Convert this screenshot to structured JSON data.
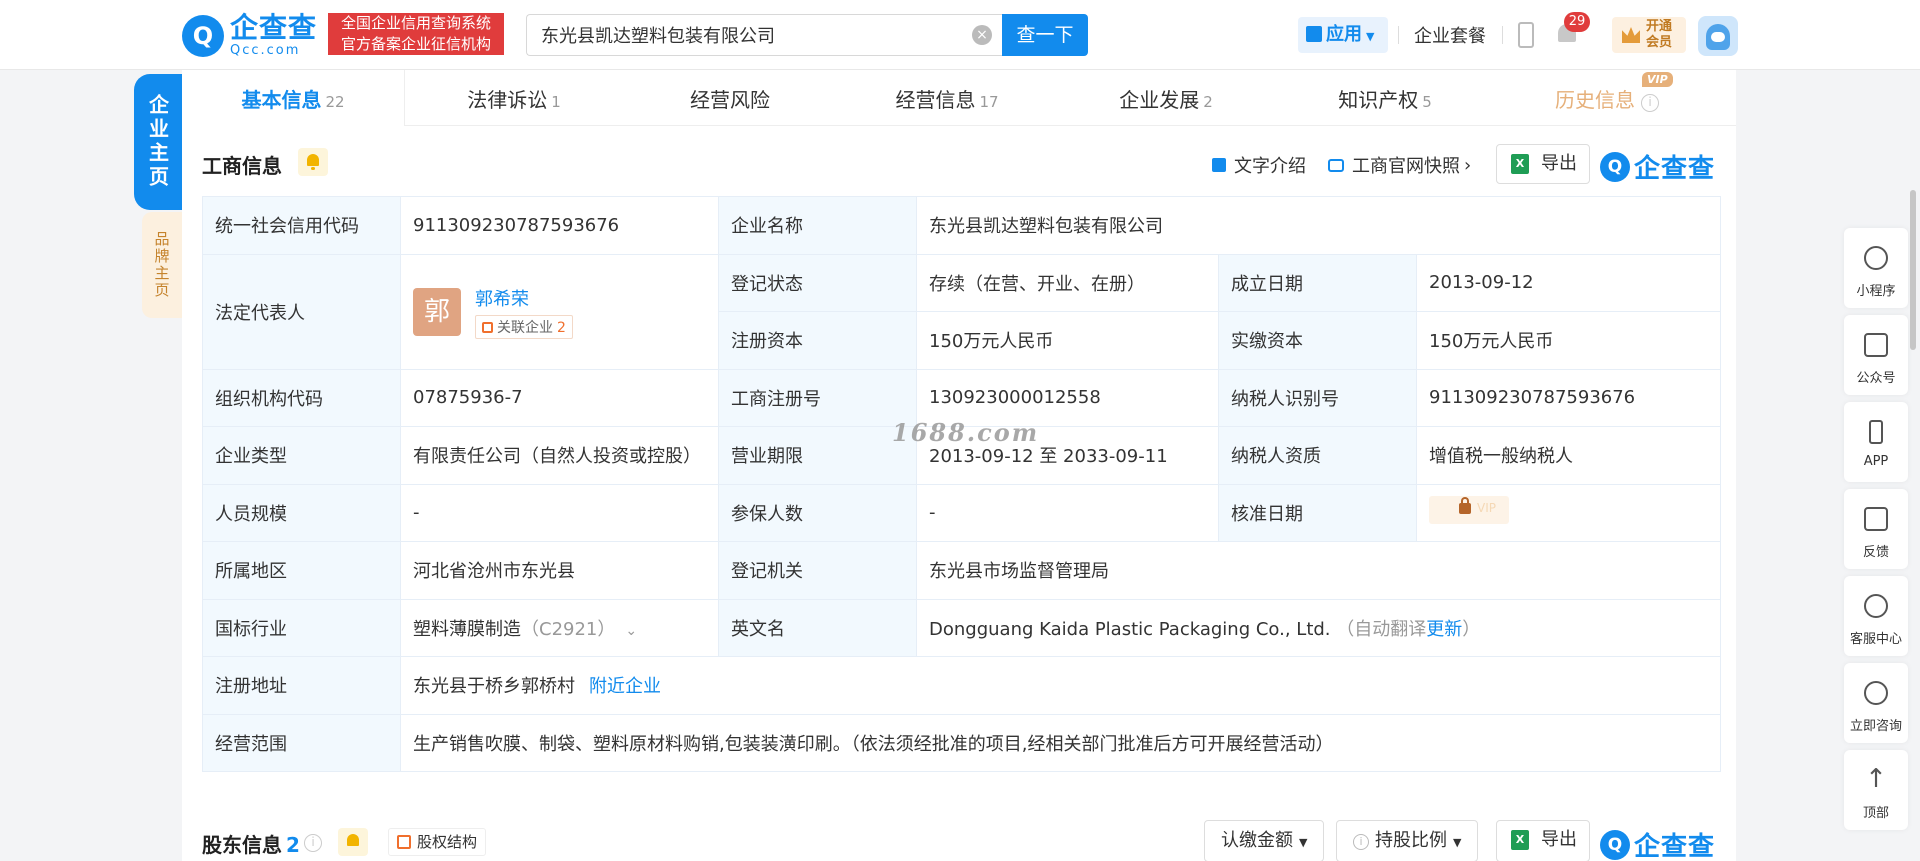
{
  "header": {
    "logo_cn": "企查查",
    "logo_en": "Qcc.com",
    "slogan_line1": "全国企业信用查询系统",
    "slogan_line2": "官方备案企业征信机构",
    "search_value": "东光县凯达塑料包装有限公司",
    "search_button": "查一下",
    "app_label": "应用",
    "package_link": "企业套餐",
    "notification_count": "29",
    "vip_line1": "开通",
    "vip_line2": "会员"
  },
  "side_tabs": {
    "main": "企业主页",
    "brand": "品牌主页"
  },
  "tabs": [
    {
      "label": "基本信息",
      "count": "22"
    },
    {
      "label": "法律诉讼",
      "count": "1"
    },
    {
      "label": "经营风险",
      "count": ""
    },
    {
      "label": "经营信息",
      "count": "17"
    },
    {
      "label": "企业发展",
      "count": "2"
    },
    {
      "label": "知识产权",
      "count": "5"
    },
    {
      "label": "历史信息",
      "count": ""
    }
  ],
  "vip_tag": "VIP",
  "section": {
    "title": "工商信息",
    "text_intro": "文字介绍",
    "snapshot": "工商官网快照",
    "export": "导出",
    "brand": "企查查"
  },
  "info": {
    "credit_code_label": "统一社会信用代码",
    "credit_code": "911309230787593676",
    "company_name_label": "企业名称",
    "company_name": "东光县凯达塑料包装有限公司",
    "legal_rep_label": "法定代表人",
    "legal_rep_avatar": "郭",
    "legal_rep_name": "郭希荣",
    "related_label": "关联企业",
    "related_count": "2",
    "reg_status_label": "登记状态",
    "reg_status": "存续（在营、开业、在册）",
    "est_date_label": "成立日期",
    "est_date": "2013-09-12",
    "reg_capital_label": "注册资本",
    "reg_capital": "150万元人民币",
    "paid_capital_label": "实缴资本",
    "paid_capital": "150万元人民币",
    "org_code_label": "组织机构代码",
    "org_code": "07875936-7",
    "biz_reg_no_label": "工商注册号",
    "biz_reg_no": "130923000012558",
    "taxpayer_id_label": "纳税人识别号",
    "taxpayer_id": "911309230787593676",
    "company_type_label": "企业类型",
    "company_type": "有限责任公司（自然人投资或控股）",
    "biz_term_label": "营业期限",
    "biz_term": "2013-09-12 至 2033-09-11",
    "taxpayer_qual_label": "纳税人资质",
    "taxpayer_qual": "增值税一般纳税人",
    "staff_size_label": "人员规模",
    "staff_size": "-",
    "insured_label": "参保人数",
    "insured": "-",
    "approval_date_label": "核准日期",
    "approval_vip": "VIP",
    "region_label": "所属地区",
    "region": "河北省沧州市东光县",
    "authority_label": "登记机关",
    "authority": "东光县市场监督管理局",
    "industry_label": "国标行业",
    "industry": "塑料薄膜制造",
    "industry_code": "（C2921）",
    "english_name_label": "英文名",
    "english_name": "Dongguang Kaida Plastic Packaging Co., Ltd.",
    "auto_translate": "（自动翻译",
    "update_link": "更新",
    "close_paren": "）",
    "address_label": "注册地址",
    "address": "东光县于桥乡郭桥村",
    "nearby_link": "附近企业",
    "scope_label": "经营范围",
    "scope": "生产销售吹膜、制袋、塑料原材料购销,包装装潢印刷。（依法须经批准的项目,经相关部门批准后方可开展经营活动）"
  },
  "watermark": "1688.com",
  "shareholders": {
    "title": "股东信息",
    "count": "2",
    "equity_structure": "股权结构",
    "subscribed_amount": "认缴金额",
    "share_ratio": "持股比例",
    "export": "导出",
    "brand": "企查查"
  },
  "right_sidebar": [
    {
      "label": "小程序",
      "icon": "miniprogram-icon"
    },
    {
      "label": "公众号",
      "icon": "official-account-icon"
    },
    {
      "label": "APP",
      "icon": "phone-icon"
    },
    {
      "label": "反馈",
      "icon": "feedback-icon"
    },
    {
      "label": "客服中心",
      "icon": "headset-icon"
    },
    {
      "label": "立即咨询",
      "icon": "chat-icon"
    },
    {
      "label": "顶部",
      "icon": "back-to-top-icon"
    }
  ]
}
